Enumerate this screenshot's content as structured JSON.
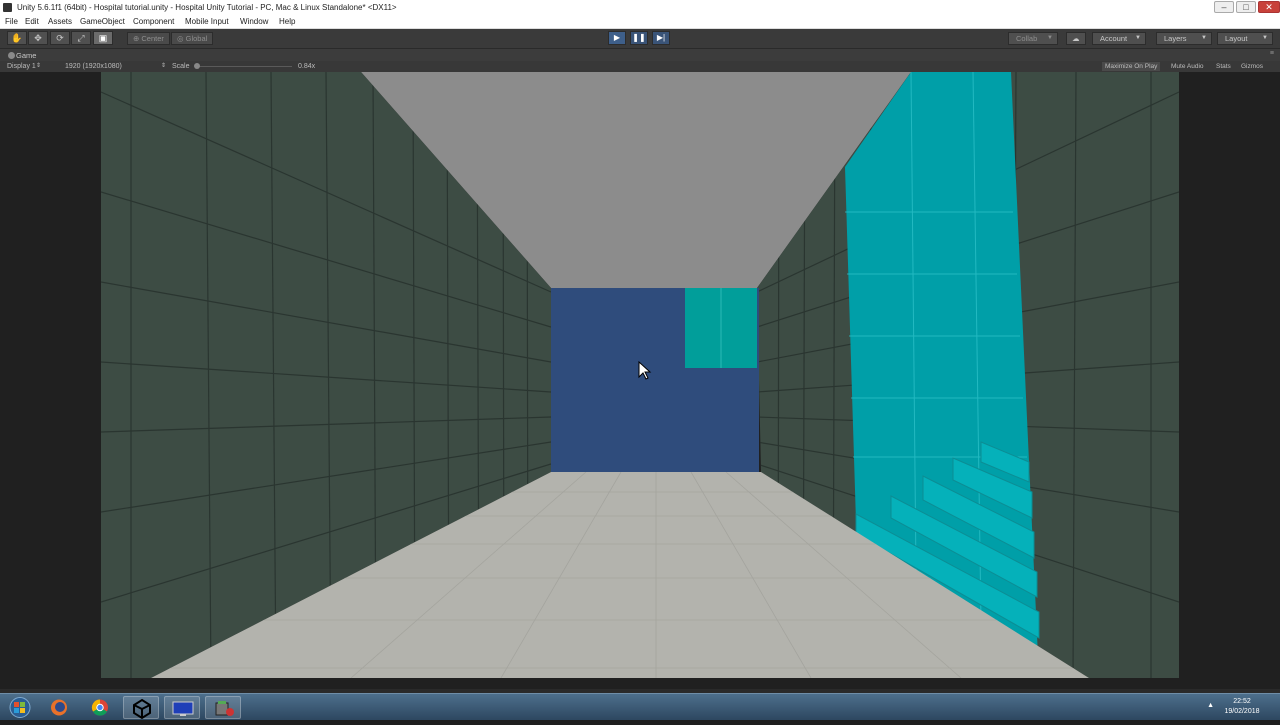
{
  "window": {
    "title": "Unity 5.6.1f1 (64bit) - Hospital tutorial.unity - Hospital Unity Tutorial - PC, Mac & Linux Standalone* <DX11>",
    "minimize": "–",
    "maximize": "□",
    "close": "✕"
  },
  "menu": {
    "items": [
      "File",
      "Edit",
      "Assets",
      "GameObject",
      "Component",
      "Mobile Input",
      "Window",
      "Help"
    ]
  },
  "toolbar": {
    "tools": [
      "hand-tool",
      "move-tool",
      "rotate-tool",
      "scale-tool",
      "rect-tool"
    ],
    "pivot": "Center",
    "space": "Global",
    "play_icon": "▶",
    "pause_icon": "❚❚",
    "step_icon": "▶|",
    "collab": "Collab",
    "account": "Account",
    "layers": "Layers",
    "layout": "Layout"
  },
  "game_tab": {
    "label": "Game",
    "display": "Display 1",
    "resolution": "1920 (1920x1080)",
    "scale_label": "Scale",
    "scale_value": "0.84x",
    "maximize_on_play": "Maximize On Play",
    "mute_audio": "Mute Audio",
    "stats": "Stats",
    "gizmos": "Gizmos"
  },
  "colors": {
    "wall": "#3e4e45",
    "ceiling": "#8a8a8a",
    "floor": "#b4b4ae",
    "end_wall": "#2f4d7d",
    "teal": "#00a4ad",
    "accent_play": "#3e5f8a"
  },
  "taskbar": {
    "apps": [
      "windows-start",
      "firefox",
      "chrome",
      "unity",
      "display-app",
      "installer-app"
    ],
    "time": "22:52",
    "date": "19/02/2018"
  }
}
